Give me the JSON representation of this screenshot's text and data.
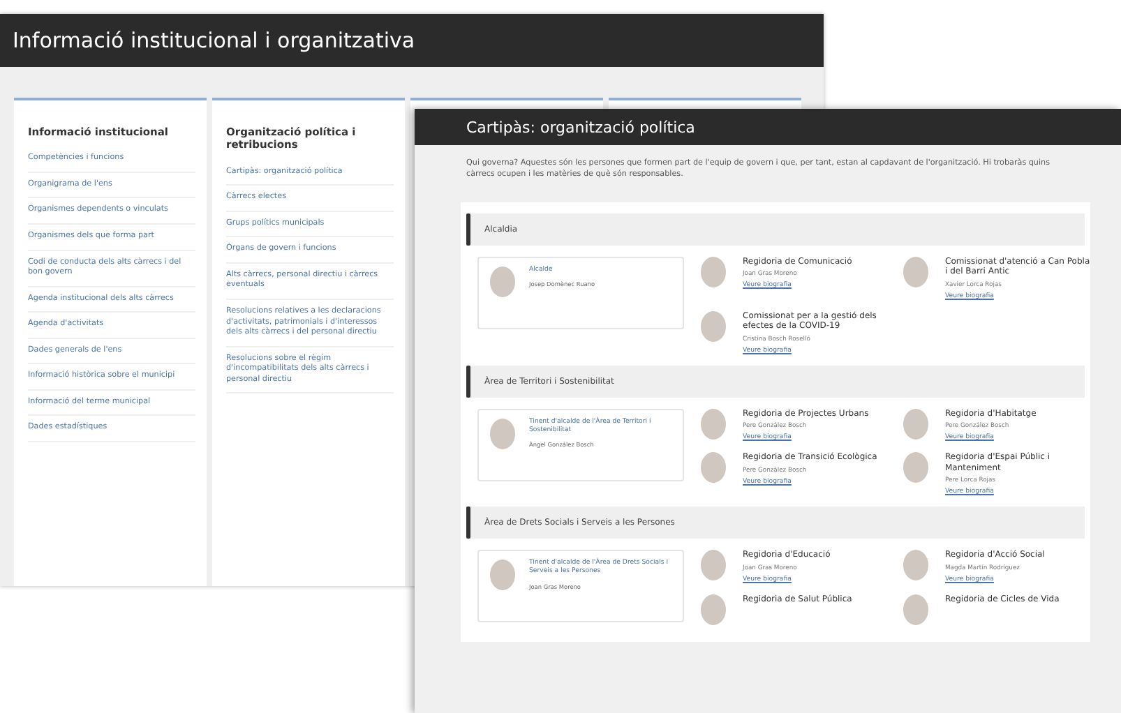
{
  "back_window": {
    "title": "Informació institucional i organitzativa",
    "columns": [
      {
        "heading": "Informació institucional",
        "links": [
          "Competències i funcions",
          "Organigrama de l'ens",
          "Organismes dependents o vinculats",
          "Organismes dels que forma part",
          "Codi de conducta dels alts càrrecs i del bon govern",
          "Agenda institucional dels alts càrrecs",
          "Agenda d'activitats",
          "Dades generals de l'ens",
          "Informació històrica sobre el municipi",
          "Informació del terme municipal",
          "Dades estadístiques"
        ]
      },
      {
        "heading": "Organització política i retribucions",
        "links": [
          "Cartipàs: organització política",
          "Càrrecs electes",
          "Grups polítics municipals",
          "Òrgans de govern i funcions",
          "Alts càrrecs, personal directiu i càrrecs eventuals",
          "Resolucions relatives a les declaracions d'activitats, patrimonials i d'interessos dels alts càrrecs i del personal directiu",
          "Resolucions sobre el règim d'incompatibilitats dels alts càrrecs i personal directiu"
        ]
      }
    ]
  },
  "front_window": {
    "title": "Cartipàs: organització política",
    "intro": "Qui governa? Aquestes són les persones que formen part de l'equip de govern i que, per tant, estan al capdavant de l'organització. Hi trobaràs quins càrrecs ocupen i les matèries de què són responsables.",
    "sections": [
      {
        "title": "Alcaldia",
        "lead": {
          "role": "Alcalde",
          "name": "Josep Domènec Ruano"
        },
        "members": [
          {
            "role": "Regidoria de Comunicació",
            "name": "Joan Gras Moreno",
            "link": "Veure biografia"
          },
          {
            "role": "Comissionat d'atenció a Can Pobla i del Barri Antic",
            "name": "Xavier Lorca Rojas",
            "link": "Veure biografia"
          },
          {
            "role": "Comissionat per a la gestió dels efectes de la COVID-19",
            "name": "Cristina Bosch Roselló",
            "link": "Veure biografia"
          }
        ]
      },
      {
        "title": "Àrea de Territori i Sostenibilitat",
        "lead": {
          "role": "Tinent d'alcalde de l'Àrea de Territori i Sostenibilitat",
          "name": "Àngel González Bosch"
        },
        "members": [
          {
            "role": "Regidoria de Projectes Urbans",
            "name": "Pere González Bosch",
            "link": "Veure biografia"
          },
          {
            "role": "Regidoria d'Habitatge",
            "name": "Pere González Bosch",
            "link": "Veure biografia"
          },
          {
            "role": "Regidoria de Transició Ecològica",
            "name": "Pere González Bosch",
            "link": "Veure biografia"
          },
          {
            "role": "Regidoria d'Espai Públic i Manteniment",
            "name": "Pere Lorca Rojas",
            "link": "Veure biografia"
          }
        ]
      },
      {
        "title": "Àrea de Drets Socials i Serveis a les Persones",
        "lead": {
          "role": "Tinent d'alcalde de l'Àrea de Drets Socials i Serveis a les Persones",
          "name": "Joan Gras Moreno"
        },
        "members": [
          {
            "role": "Regidoria d'Educació",
            "name": "Joan Gras Moreno",
            "link": "Veure biografia"
          },
          {
            "role": "Regidoria d'Acció Social",
            "name": "Magda Martín Rodríguez",
            "link": "Veure biografia"
          },
          {
            "role": "Regidoria de Salut Pública"
          },
          {
            "role": "Regidoria de Cicles de Vida"
          }
        ]
      }
    ]
  }
}
